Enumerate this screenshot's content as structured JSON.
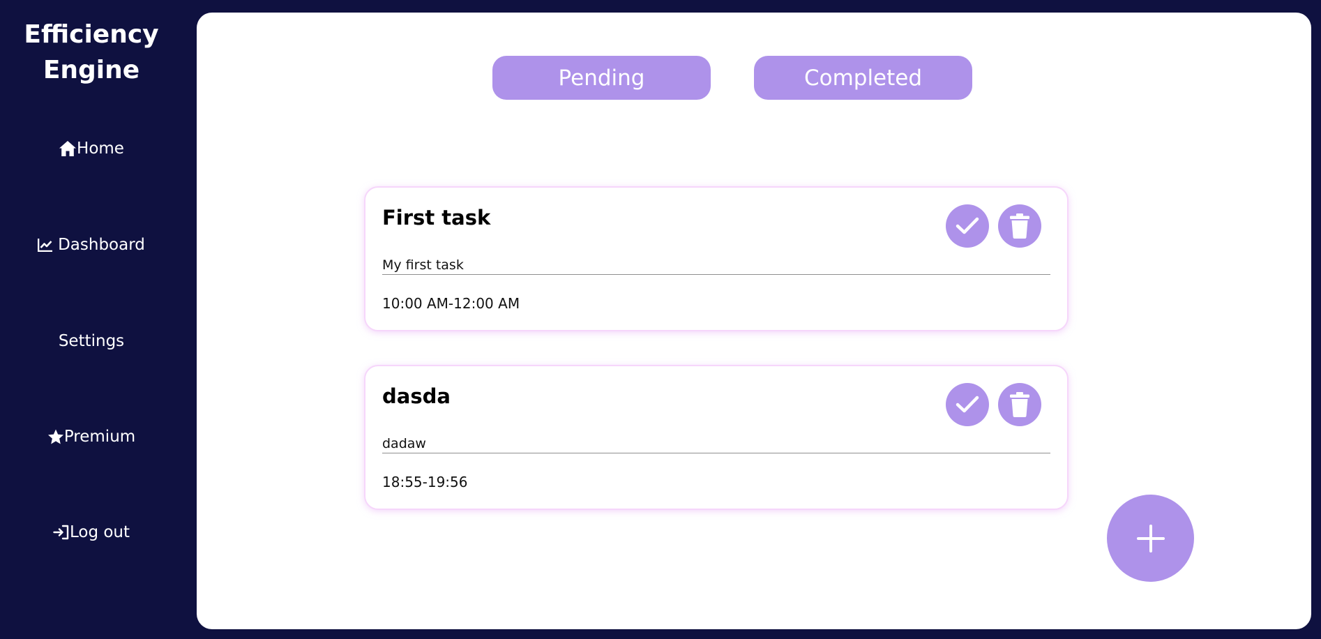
{
  "app": {
    "brand": "Efficiency Engine"
  },
  "sidebar": {
    "items": [
      {
        "label": "Home",
        "icon": "home-icon"
      },
      {
        "label": "Dashboard",
        "icon": "chart-line-icon"
      },
      {
        "label": "Settings",
        "icon": ""
      },
      {
        "label": "Premium",
        "icon": "star-icon"
      },
      {
        "label": "Log out",
        "icon": "sign-in-icon"
      }
    ]
  },
  "tabs": [
    {
      "label": "Pending"
    },
    {
      "label": "Completed"
    }
  ],
  "tasks": [
    {
      "title": "First task",
      "description": "My first task",
      "time": "10:00 AM-12:00 AM"
    },
    {
      "title": "dasda",
      "description": "dadaw",
      "time": "18:55-19:56"
    }
  ],
  "colors": {
    "background": "#0f1140",
    "accent": "#ae92ea",
    "panel": "#ffffff",
    "card_border": "#f6d6fb"
  },
  "actions": {
    "complete_icon": "check-icon",
    "delete_icon": "trash-icon",
    "add_icon": "plus-icon"
  }
}
